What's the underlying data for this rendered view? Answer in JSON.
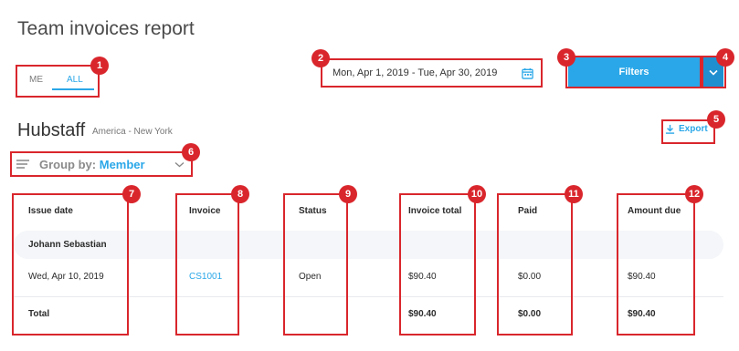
{
  "page": {
    "title": "Team invoices report"
  },
  "toggle": {
    "me": "ME",
    "all": "ALL",
    "selected": "ALL"
  },
  "date_range": {
    "value": "Mon, Apr 1, 2019 - Tue, Apr 30, 2019",
    "icon": "calendar-icon"
  },
  "filters": {
    "label": "Filters",
    "dropdown_icon": "chevron-down-icon"
  },
  "org": {
    "name": "Hubstaff",
    "timezone": "America - New York"
  },
  "export": {
    "label": "Export",
    "icon": "download-icon"
  },
  "group_by": {
    "label": "Group by:",
    "value": "Member",
    "icon": "menu-lines-icon"
  },
  "table": {
    "columns": [
      "Issue date",
      "Invoice",
      "Status",
      "Invoice total",
      "Paid",
      "Amount due"
    ],
    "group": {
      "name": "Johann Sebastian"
    },
    "rows": [
      {
        "issue_date": "Wed, Apr 10, 2019",
        "invoice": "CS1001",
        "status": "Open",
        "invoice_total": "$90.40",
        "paid": "$0.00",
        "amount_due": "$90.40"
      }
    ],
    "total": {
      "label": "Total",
      "invoice_total": "$90.40",
      "paid": "$0.00",
      "amount_due": "$90.40"
    }
  },
  "annotations": [
    "1",
    "2",
    "3",
    "4",
    "5",
    "6",
    "7",
    "8",
    "9",
    "10",
    "11",
    "12"
  ],
  "colors": {
    "accent": "#2aa7e8",
    "annotation": "#d9262c"
  }
}
